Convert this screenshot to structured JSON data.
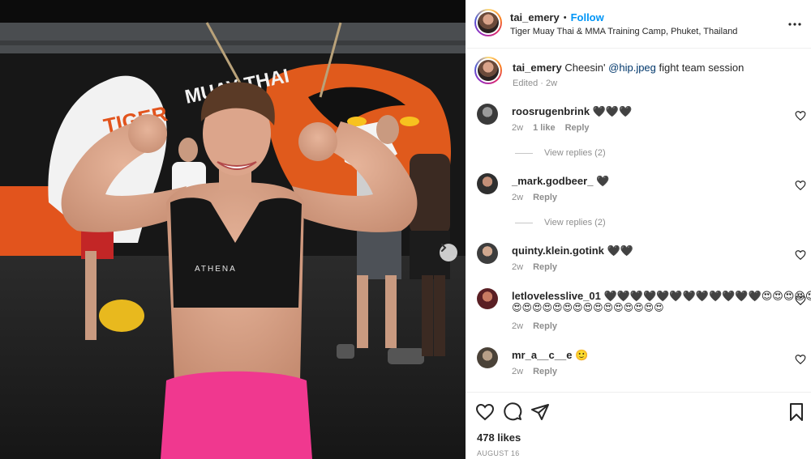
{
  "post": {
    "author": "tai_emery",
    "follow_label": "Follow",
    "separator": "•",
    "location": "Tiger Muay Thai & MMA Training Camp, Phuket, Thailand",
    "caption": {
      "username": "tai_emery",
      "text_before": "Cheesin'",
      "mention": "@hip.jpeg",
      "text_after": "fight team session",
      "edited": "Edited",
      "dot": "·",
      "time": "2w"
    },
    "likes": "478 likes",
    "date": "AUGUST 16",
    "photo": {
      "banner_text": "TIGER MUAY THAI",
      "shirt_text": "ATHENA"
    }
  },
  "comments": [
    {
      "username": "roosrugenbrink",
      "text": "🖤🖤🖤",
      "time": "2w",
      "likes": "1 like",
      "reply": "Reply",
      "replies": "View replies (2)"
    },
    {
      "username": "_mark.godbeer_",
      "text": "🖤",
      "time": "2w",
      "reply": "Reply",
      "replies": "View replies (2)"
    },
    {
      "username": "quinty.klein.gotink",
      "text": "🖤🖤",
      "time": "2w",
      "reply": "Reply"
    },
    {
      "username": "letlovelesslive_01",
      "text": "🖤🖤🖤🖤🖤🖤🖤🖤🖤🖤🖤🖤😍😍😍😍😍😍",
      "text2": "😍😍😍😍😍😍😍😍😍😍😍😍😍😍😍",
      "time": "2w",
      "reply": "Reply"
    },
    {
      "username": "mr_a__c__e",
      "text": "🙂",
      "time": "2w",
      "reply": "Reply"
    }
  ],
  "colors": {
    "follow_blue": "#0095f6",
    "mention_blue": "#00376b",
    "meta_gray": "#8e8e8e",
    "shorts_pink": "#f0388f"
  }
}
